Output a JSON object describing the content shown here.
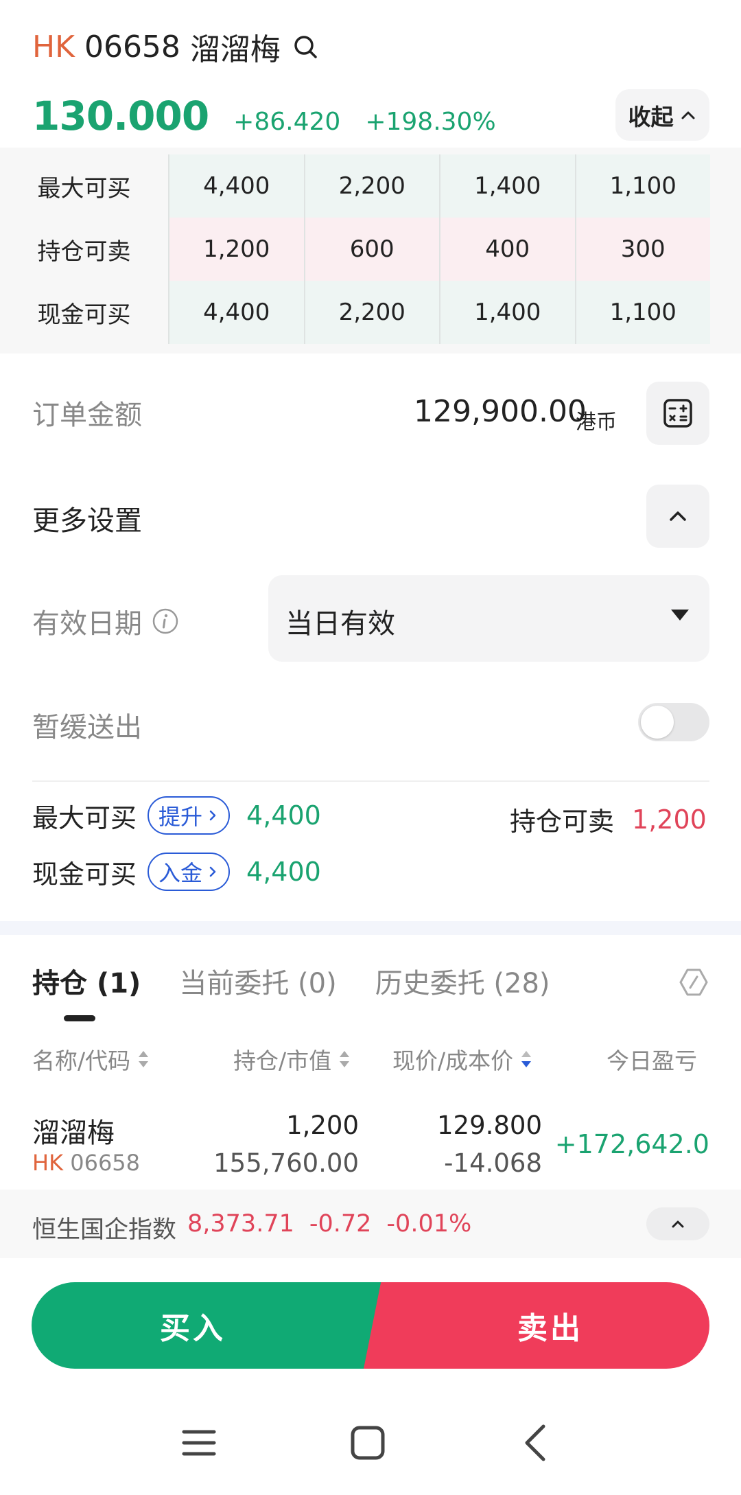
{
  "header": {
    "market": "HK",
    "code": "06658",
    "name": "溜溜梅",
    "search_icon": "search-icon"
  },
  "quote": {
    "price": "130.000",
    "change": "+86.420",
    "change_pct": "+198.30%",
    "collapse_label": "收起"
  },
  "qty_table": {
    "rows": [
      {
        "label": "最大可买",
        "values": [
          "4,400",
          "2,200",
          "1,400",
          "1,100"
        ]
      },
      {
        "label": "持仓可卖",
        "values": [
          "1,200",
          "600",
          "400",
          "300"
        ]
      },
      {
        "label": "现金可买",
        "values": [
          "4,400",
          "2,200",
          "1,400",
          "1,100"
        ]
      }
    ]
  },
  "order": {
    "amount_label": "订单金额",
    "amount_value": "129,900.00",
    "amount_unit": "港币"
  },
  "settings": {
    "more_label": "更多设置",
    "validity_label": "有效日期",
    "validity_value": "当日有效",
    "delay_label": "暂缓送出",
    "delay_enabled": false
  },
  "summary": {
    "max_buy_label": "最大可买",
    "max_buy_pill": "提升",
    "max_buy_value": "4,400",
    "cash_buy_label": "现金可买",
    "cash_buy_pill": "入金",
    "cash_buy_value": "4,400",
    "sell_label": "持仓可卖",
    "sell_value": "1,200"
  },
  "tabs": [
    {
      "label": "持仓 (1)",
      "active": true
    },
    {
      "label": "当前委托 (0)",
      "active": false
    },
    {
      "label": "历史委托 (28)",
      "active": false
    }
  ],
  "holdings": {
    "headers": {
      "name": "名称/代码",
      "position": "持仓/市值",
      "price": "现价/成本价",
      "pnl": "今日盈亏"
    },
    "rows": [
      {
        "name": "溜溜梅",
        "market": "HK",
        "code": "06658",
        "qty": "1,200",
        "market_value": "155,760.00",
        "price": "129.800",
        "cost": "-14.068",
        "pnl": "+172,642.0"
      }
    ]
  },
  "index": {
    "name": "恒生国企指数",
    "value": "8,373.71",
    "change": "-0.72",
    "change_pct": "-0.01%"
  },
  "actions": {
    "buy": "买入",
    "sell": "卖出"
  },
  "colors": {
    "up": "#1aa370",
    "down": "#e04459",
    "market": "#e0643c",
    "link": "#2a5bd7"
  }
}
